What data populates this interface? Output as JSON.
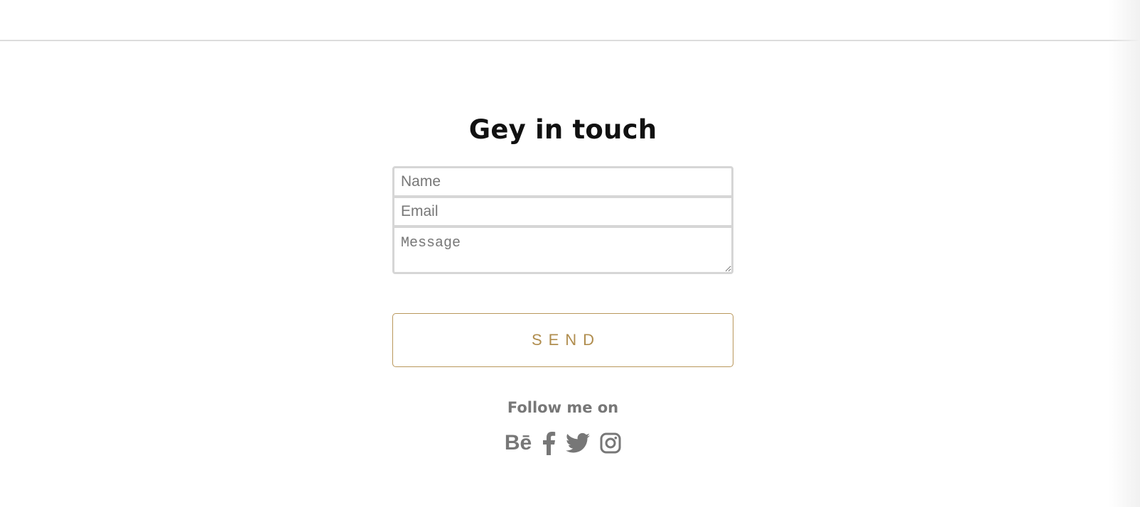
{
  "contact": {
    "title": "Gey in touch",
    "name_placeholder": "Name",
    "email_placeholder": "Email",
    "message_placeholder": "Message",
    "send_label": "SEND"
  },
  "social": {
    "follow_label": "Follow me on",
    "icons": [
      "behance-icon",
      "facebook-icon",
      "twitter-icon",
      "instagram-icon"
    ],
    "behance_text": "Bē",
    "icon_color": "#777777"
  },
  "colors": {
    "accent": "#b08d4e",
    "field_border": "#d6d6d6"
  }
}
